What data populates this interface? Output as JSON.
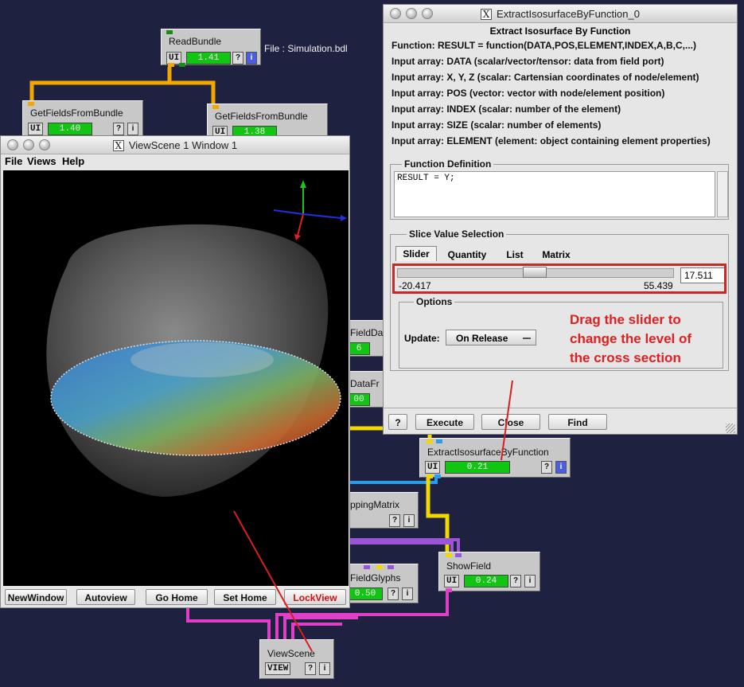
{
  "network": {
    "file_label": "File : Simulation.bdl",
    "modules": {
      "readbundle": {
        "title": "ReadBundle",
        "ui": "UI",
        "progress": "1.41"
      },
      "gfb1": {
        "title": "GetFieldsFromBundle",
        "ui": "UI",
        "progress": "1.40"
      },
      "gfb2": {
        "title": "GetFieldsFromBundle",
        "ui": "UI",
        "progress": "1.38"
      },
      "partial1": {
        "title": "FieldDa",
        "progress": "6"
      },
      "partial2": {
        "title": "DataFr",
        "progress": "00"
      },
      "partial3": {
        "title": "ppingMatrix"
      },
      "partial4": {
        "title": "FieldGlyphs",
        "progress": "0.50"
      },
      "extract": {
        "title": "ExtractIsosurfaceByFunction",
        "ui": "UI",
        "progress": "0.21"
      },
      "showfield": {
        "title": "ShowField",
        "ui": "UI",
        "progress": "0.24"
      },
      "viewscene": {
        "title": "ViewScene",
        "ui": "VIEW"
      }
    },
    "q": "?",
    "i": "i"
  },
  "viewscene_window": {
    "title": "ViewScene 1 Window 1",
    "menu": [
      "File",
      "Views",
      "Help"
    ],
    "buttons": {
      "newwindow": "NewWindow",
      "autoview": "Autoview",
      "gohome": "Go Home",
      "sethome": "Set Home",
      "lockview": "LockView"
    }
  },
  "extract_window": {
    "title": "ExtractIsosurfaceByFunction_0",
    "header": "Extract Isosurface By Function",
    "info_lines": [
      "Function: RESULT = function(DATA,POS,ELEMENT,INDEX,A,B,C,...)",
      "Input array: DATA (scalar/vector/tensor: data from field port)",
      "Input array: X, Y, Z (scalar: Cartensian coordinates of node/element)",
      "Input array: POS (vector: vector with node/element position)",
      "Input array: INDEX (scalar: number of the element)",
      "Input array: SIZE (scalar: number of elements)",
      "Input array: ELEMENT (element: object containing element properties)"
    ],
    "function_definition_label": "Function Definition",
    "function_text": "RESULT = Y;",
    "slice_label": "Slice Value Selection",
    "tabs": [
      "Slider",
      "Quantity",
      "List",
      "Matrix"
    ],
    "slider": {
      "min": "-20.417",
      "max": "55.439",
      "value": "17.511",
      "fraction": 0.497
    },
    "options_label": "Options",
    "update_label": "Update:",
    "update_value": "On Release",
    "help_button": "?",
    "buttons": {
      "execute": "Execute",
      "close": "Close",
      "find": "Find"
    }
  },
  "annotation": {
    "line1": "Drag the slider to",
    "line2": "change the level of",
    "line3": "the cross section",
    "color": "#e02020"
  },
  "colors": {
    "yellow_wire": "#f2d000",
    "orange_wire": "#f0a000",
    "blue_wire": "#2a9de8",
    "purple_wire": "#9b55d8",
    "magenta_wire": "#e040c8",
    "progress_green": "#13c513"
  }
}
